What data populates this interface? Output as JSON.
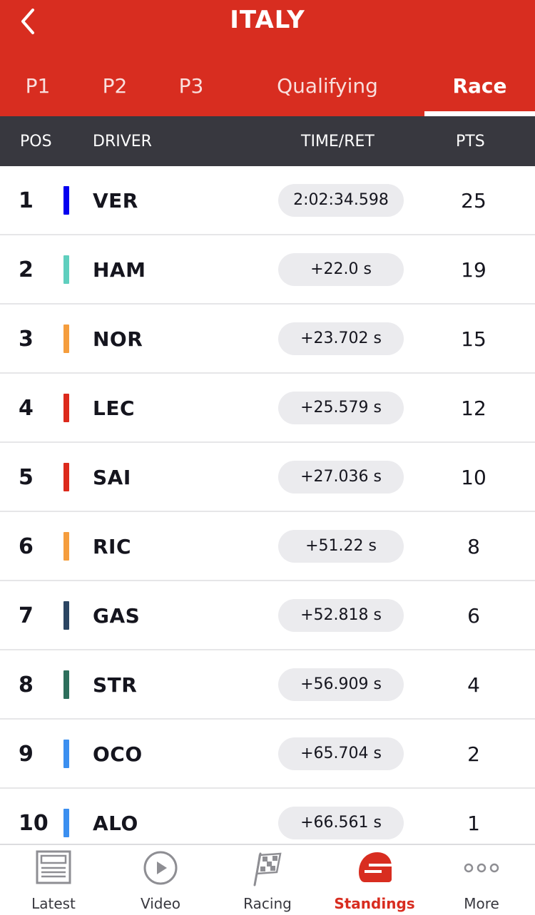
{
  "header": {
    "title": "ITALY",
    "tabs": [
      "P1",
      "P2",
      "P3",
      "Qualifying",
      "Race"
    ],
    "active_tab": "Race"
  },
  "columns": {
    "pos": "POS",
    "driver": "DRIVER",
    "time": "TIME/RET",
    "pts": "PTS"
  },
  "results": [
    {
      "pos": "1",
      "driver": "VER",
      "time": "2:02:34.598",
      "pts": "25",
      "team_color": "#0600ef"
    },
    {
      "pos": "2",
      "driver": "HAM",
      "time": "+22.0 s",
      "pts": "19",
      "team_color": "#5fcfbe"
    },
    {
      "pos": "3",
      "driver": "NOR",
      "time": "+23.702 s",
      "pts": "15",
      "team_color": "#f59d3d"
    },
    {
      "pos": "4",
      "driver": "LEC",
      "time": "+25.579 s",
      "pts": "12",
      "team_color": "#dc2a1c"
    },
    {
      "pos": "5",
      "driver": "SAI",
      "time": "+27.036 s",
      "pts": "10",
      "team_color": "#dc2a1c"
    },
    {
      "pos": "6",
      "driver": "RIC",
      "time": "+51.22 s",
      "pts": "8",
      "team_color": "#f59d3d"
    },
    {
      "pos": "7",
      "driver": "GAS",
      "time": "+52.818 s",
      "pts": "6",
      "team_color": "#2b4562"
    },
    {
      "pos": "8",
      "driver": "STR",
      "time": "+56.909 s",
      "pts": "4",
      "team_color": "#2d6f5c"
    },
    {
      "pos": "9",
      "driver": "OCO",
      "time": "+65.704 s",
      "pts": "2",
      "team_color": "#3b8ff0"
    },
    {
      "pos": "10",
      "driver": "ALO",
      "time": "+66.561 s",
      "pts": "1",
      "team_color": "#3b8ff0"
    }
  ],
  "nav": {
    "items": [
      {
        "label": "Latest",
        "icon": "newspaper-icon"
      },
      {
        "label": "Video",
        "icon": "play-circle-icon"
      },
      {
        "label": "Racing",
        "icon": "checkered-flag-icon"
      },
      {
        "label": "Standings",
        "icon": "helmet-icon"
      },
      {
        "label": "More",
        "icon": "more-dots-icon"
      }
    ],
    "active": "Standings"
  },
  "colors": {
    "brand_red": "#d82d20",
    "header_dark": "#38383f",
    "pill_bg": "#ebebee"
  }
}
